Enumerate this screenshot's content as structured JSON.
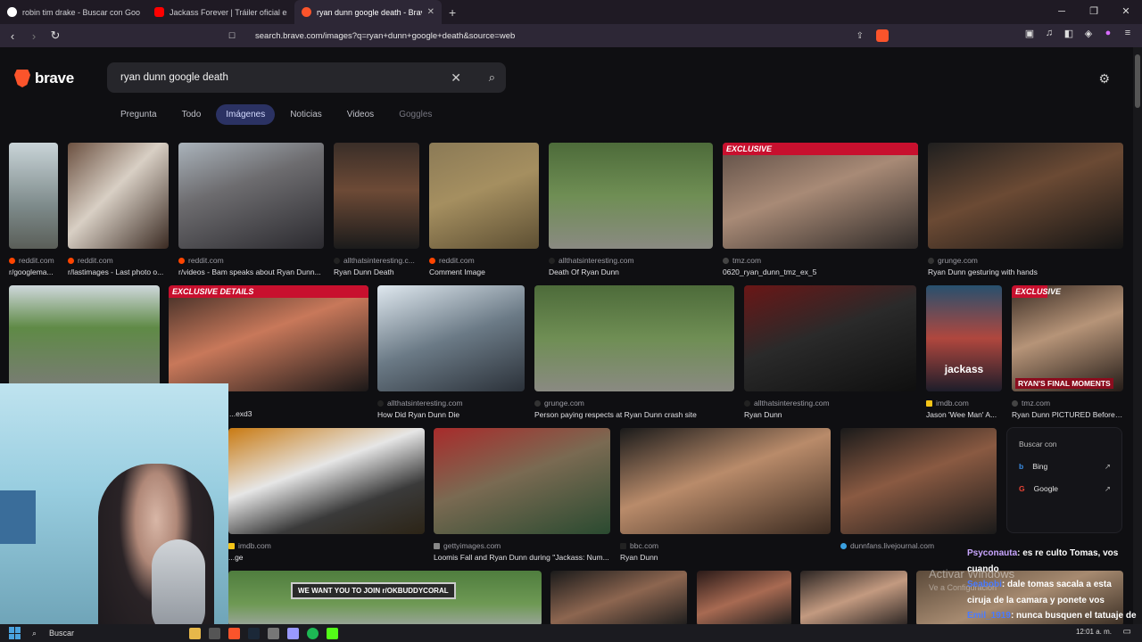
{
  "tabs": [
    {
      "title": "robin tim drake - Buscar con Google",
      "color": "#ffffff"
    },
    {
      "title": "Jackass Forever | Tráiler oficial españ",
      "color": "#ff0000"
    },
    {
      "title": "ryan dunn google death - Brave",
      "color": "#fb542b",
      "active": true
    }
  ],
  "address": "search.brave.com/images?q=ryan+dunn+google+death&source=web",
  "brand": "brave",
  "search": {
    "query": "ryan dunn google death"
  },
  "search_tabs": [
    "Pregunta",
    "Todo",
    "Imágenes",
    "Noticias",
    "Videos",
    "Goggles"
  ],
  "active_tab": "Imágenes",
  "results_row1": [
    {
      "src": "reddit.com",
      "cap": "r/googlema...",
      "color": "#ff4500"
    },
    {
      "src": "reddit.com",
      "cap": "r/lastimages - Last photo o...",
      "color": "#ff4500"
    },
    {
      "src": "reddit.com",
      "cap": "r/videos - Bam speaks about Ryan Dunn...",
      "color": "#ff4500"
    },
    {
      "src": "allthatsinteresting.c...",
      "cap": "Ryan Dunn Death",
      "color": "#222222"
    },
    {
      "src": "reddit.com",
      "cap": "Comment Image",
      "color": "#ff4500"
    },
    {
      "src": "allthatsinteresting.com",
      "cap": "Death Of Ryan Dunn",
      "color": "#222222"
    },
    {
      "src": "tmz.com",
      "cap": "0620_ryan_dunn_tmz_ex_5",
      "color": "#444444",
      "banner": "EXCLUSIVE"
    },
    {
      "src": "grunge.com",
      "cap": "Ryan Dunn gesturing with hands",
      "color": "#333333"
    }
  ],
  "results_row2": [
    {
      "src": "",
      "cap": "",
      "color": "#555555"
    },
    {
      "src": "",
      "cap": "...exd3",
      "color": "#555555",
      "banner": "EXCLUSIVE DETAILS"
    },
    {
      "src": "allthatsinteresting.com",
      "cap": "How Did Ryan Dunn Die",
      "color": "#222222"
    },
    {
      "src": "grunge.com",
      "cap": "Person paying respects at Ryan Dunn crash site",
      "color": "#333333"
    },
    {
      "src": "allthatsinteresting.com",
      "cap": "Ryan Dunn",
      "color": "#222222"
    },
    {
      "src": "imdb.com",
      "cap": "Jason 'Wee Man' A...",
      "color": "#f5c518",
      "overlay": "jackass"
    },
    {
      "src": "tmz.com",
      "cap": "Ryan Dunn PICTURED Before ...",
      "color": "#444444",
      "banner": "EXCLUSIVE",
      "bottom": "RYAN'S FINAL MOMENTS"
    }
  ],
  "results_row3": [
    {
      "src": "imdb.com",
      "cap": "...ge",
      "color": "#f5c518"
    },
    {
      "src": "gettyimages.com",
      "cap": "Loomis Fall and Ryan Dunn during \"Jackass: Num...",
      "color": "#888888"
    },
    {
      "src": "bbc.com",
      "cap": "Ryan Dunn",
      "color": "#222222"
    },
    {
      "src": "dunnfans.livejournal.com",
      "cap": "",
      "color": "#3aa0e0"
    }
  ],
  "row4_sign": "WE WANT YOU TO JOIN r/OKBUDDYCORAL",
  "search_with": {
    "title": "Buscar con",
    "options": [
      "Bing",
      "Google"
    ]
  },
  "watermark": {
    "line1": "Activar Windows",
    "line2": "Ve a Configuración"
  },
  "chat": [
    {
      "user": "Psyconauta",
      "user_color": "#c9a6ff",
      "text": ": es re culto Tomas, vos cuando"
    },
    {
      "user": "Seabobi",
      "user_color": "#4a7bff",
      "text": ": dale tomas sacala a esta ciruja de la camara y ponete vos"
    },
    {
      "user": "Emil_1919",
      "user_color": "#4a7bff",
      "text": ": nunca busquen el tatuaje de steve o"
    }
  ],
  "taskbar": {
    "search": "Buscar",
    "time": "12:01 a. m."
  }
}
